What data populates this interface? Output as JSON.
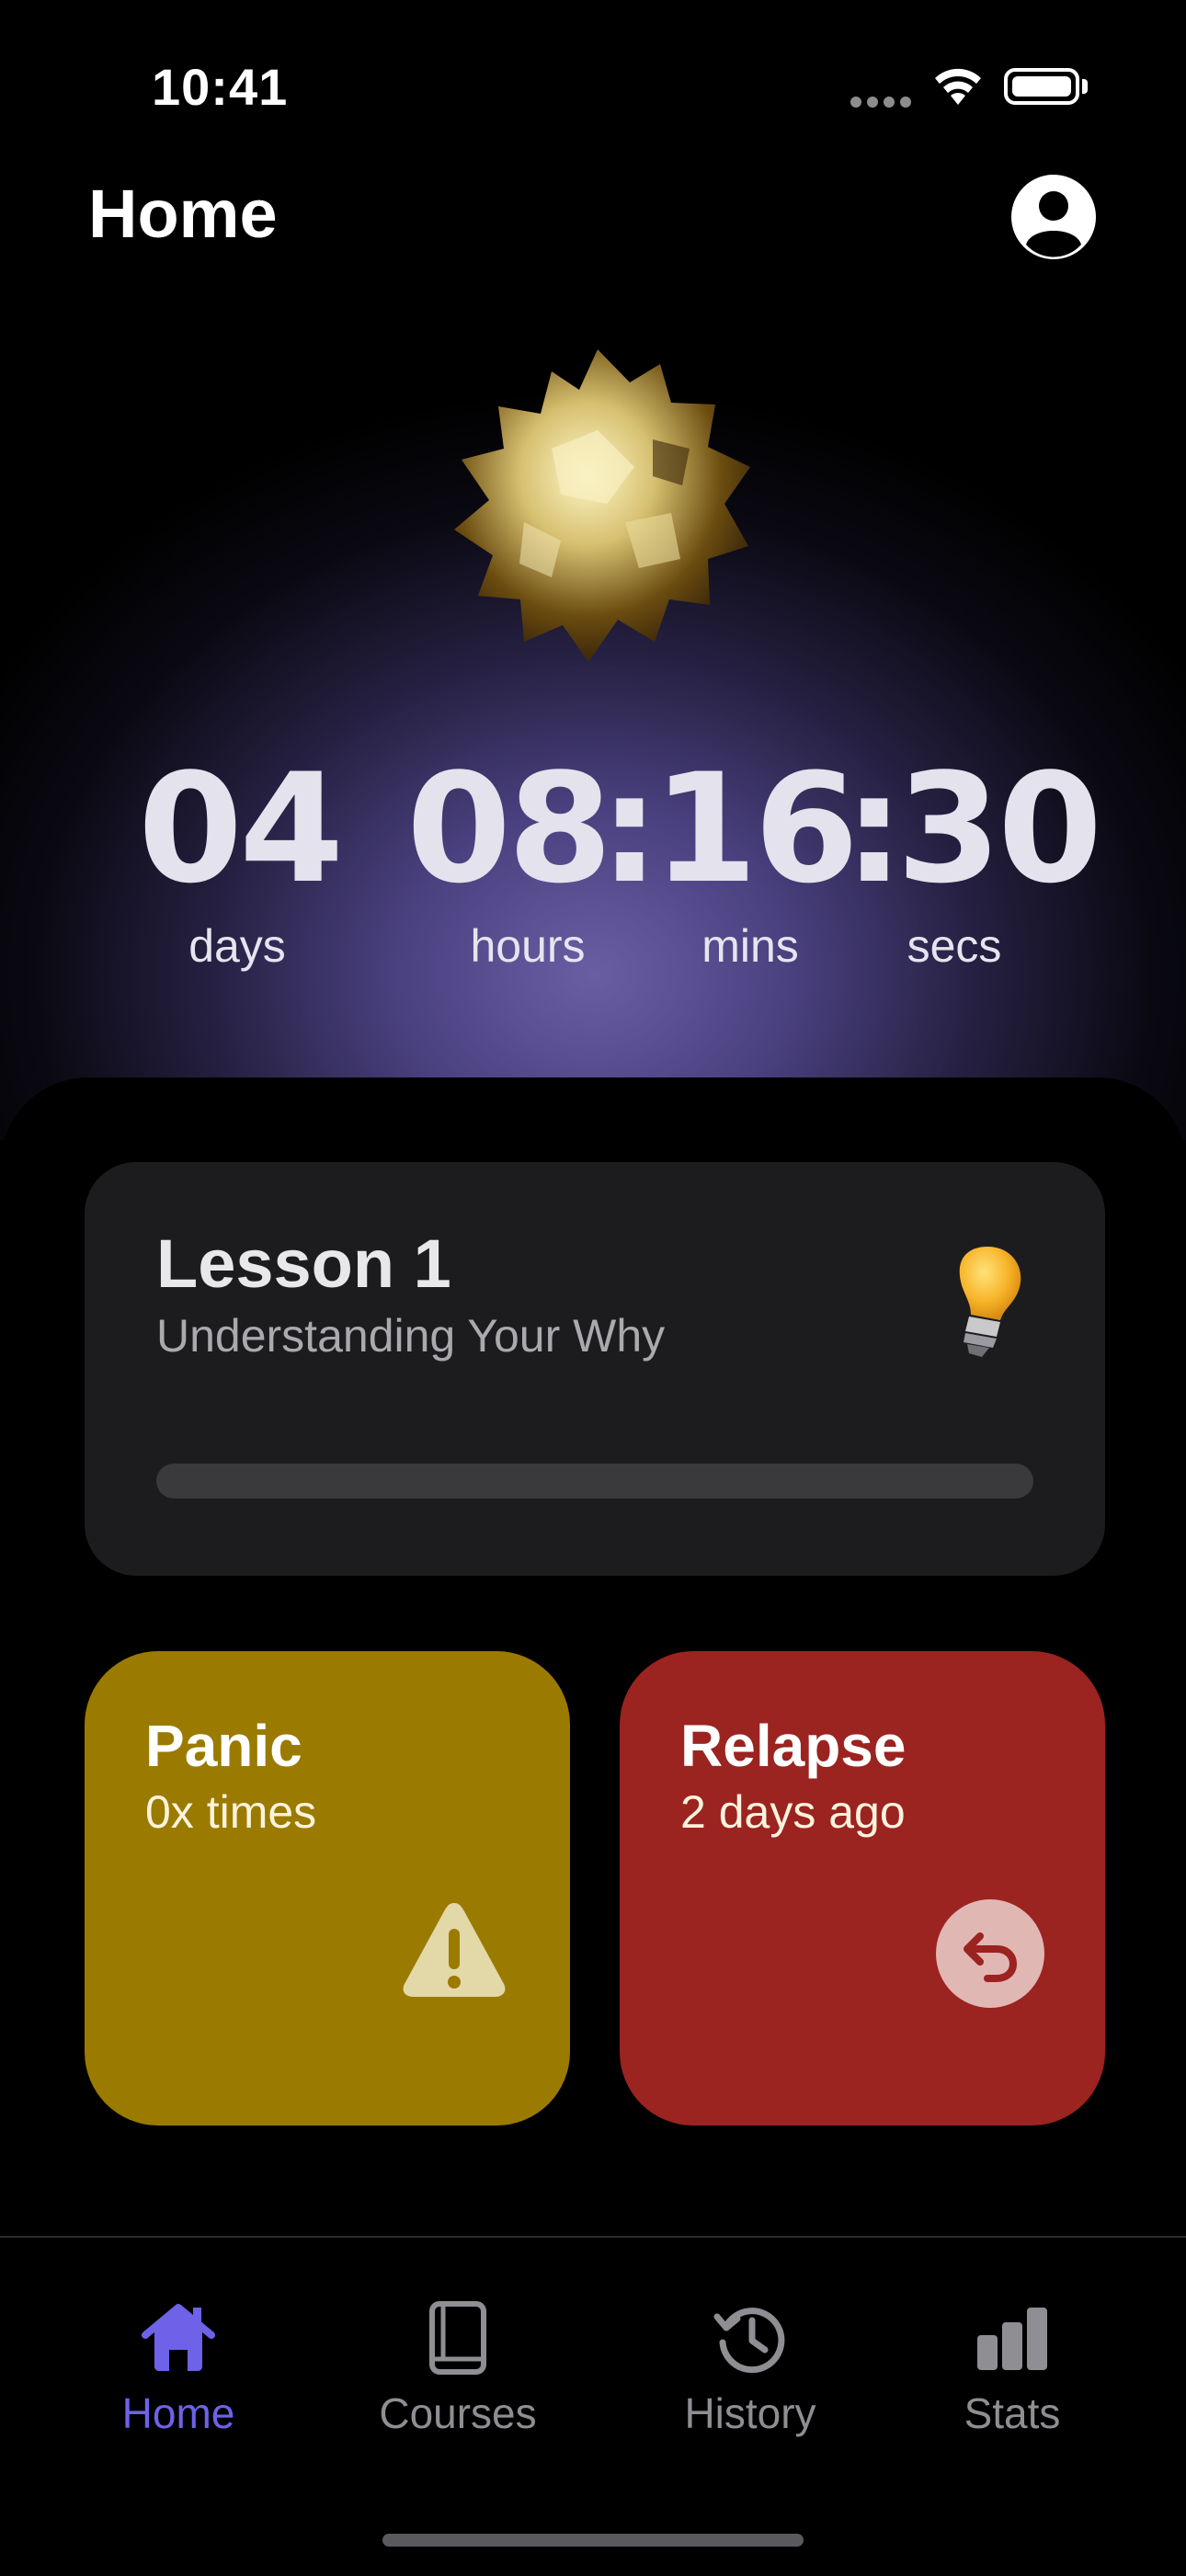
{
  "status_bar": {
    "time": "10:41"
  },
  "header": {
    "title": "Home"
  },
  "counter": {
    "days": "04",
    "hours": "08",
    "mins": "16",
    "secs": "30",
    "sep": ":",
    "labels": {
      "days": "days",
      "hours": "hours",
      "mins": "mins",
      "secs": "secs"
    }
  },
  "lesson": {
    "title": "Lesson 1",
    "subtitle": "Understanding Your Why",
    "progress": 0
  },
  "panic": {
    "title": "Panic",
    "subtitle": "0x times",
    "icon": "warning-icon"
  },
  "relapse": {
    "title": "Relapse",
    "subtitle": "2 days ago",
    "icon": "undo-icon"
  },
  "tabs": [
    {
      "label": "Home",
      "icon": "house-icon",
      "active": true
    },
    {
      "label": "Courses",
      "icon": "book-icon",
      "active": false
    },
    {
      "label": "History",
      "icon": "history-icon",
      "active": false
    },
    {
      "label": "Stats",
      "icon": "bar-chart-icon",
      "active": false
    }
  ],
  "colors": {
    "accent": "#6e62e8",
    "panic": "#9b7a00",
    "relapse": "#9b2320",
    "card": "#1c1c1e"
  }
}
